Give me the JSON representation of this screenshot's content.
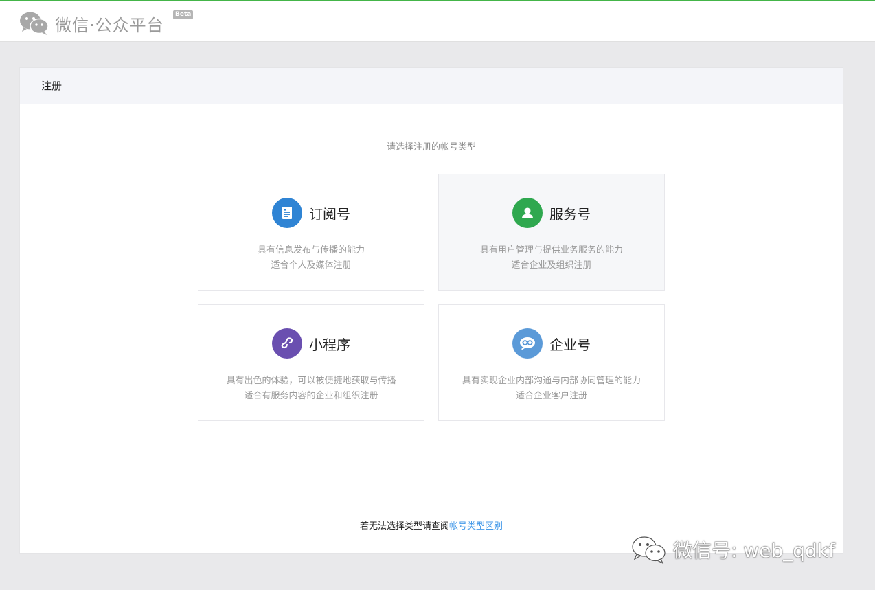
{
  "header": {
    "logo_text": "微信·公众平台",
    "beta_badge": "Beta"
  },
  "panel": {
    "title": "注册",
    "prompt": "请选择注册的帐号类型"
  },
  "cards": [
    {
      "title": "订阅号",
      "icon": "document-icon",
      "icon_color": "#2f84d4",
      "desc_line1": "具有信息发布与传播的能力",
      "desc_line2": "适合个人及媒体注册"
    },
    {
      "title": "服务号",
      "icon": "user-icon",
      "icon_color": "#2fa84f",
      "desc_line1": "具有用户管理与提供业务服务的能力",
      "desc_line2": "适合企业及组织注册"
    },
    {
      "title": "小程序",
      "icon": "mini-program-icon",
      "icon_color": "#6a4fb0",
      "desc_line1": "具有出色的体验，可以被便捷地获取与传播",
      "desc_line2": "适合有服务内容的企业和组织注册"
    },
    {
      "title": "企业号",
      "icon": "enterprise-icon",
      "icon_color": "#5b9ad8",
      "desc_line1": "具有实现企业内部沟通与内部协同管理的能力",
      "desc_line2": "适合企业客户注册"
    }
  ],
  "footer": {
    "prefix": "若无法选择类型请查阅",
    "link": "帐号类型区别"
  },
  "watermark": {
    "text": "微信号: web_qdkf"
  }
}
